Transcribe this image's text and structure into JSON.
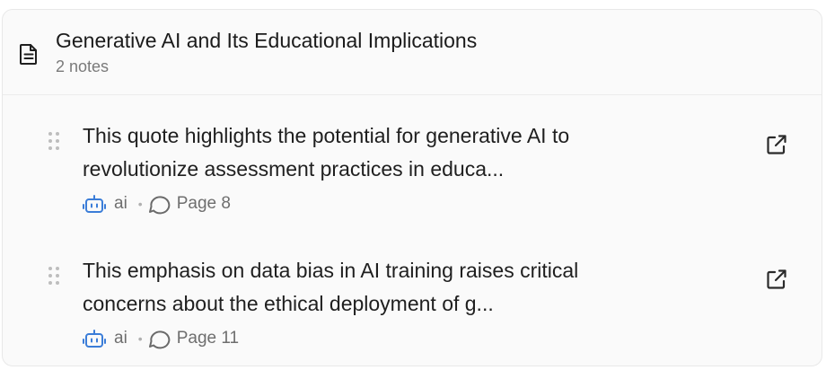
{
  "group": {
    "title": "Generative AI and Its Educational Implications",
    "count_label": "2 notes",
    "icon": "document-icon"
  },
  "notes": [
    {
      "text_line1": "This quote highlights the potential for generative AI to",
      "text_line2": "revolutionize assessment practices in educa...",
      "author": "ai",
      "separator": "•",
      "page": "Page 8"
    },
    {
      "text_line1": "This emphasis on data bias in AI training raises critical",
      "text_line2": "concerns about the ethical deployment of g...",
      "author": "ai",
      "separator": "•",
      "page": "Page 11"
    }
  ],
  "colors": {
    "ai_accent": "#3b7dd8",
    "muted_text": "#6e6e6e",
    "icon_gray": "#6a6a6a"
  }
}
